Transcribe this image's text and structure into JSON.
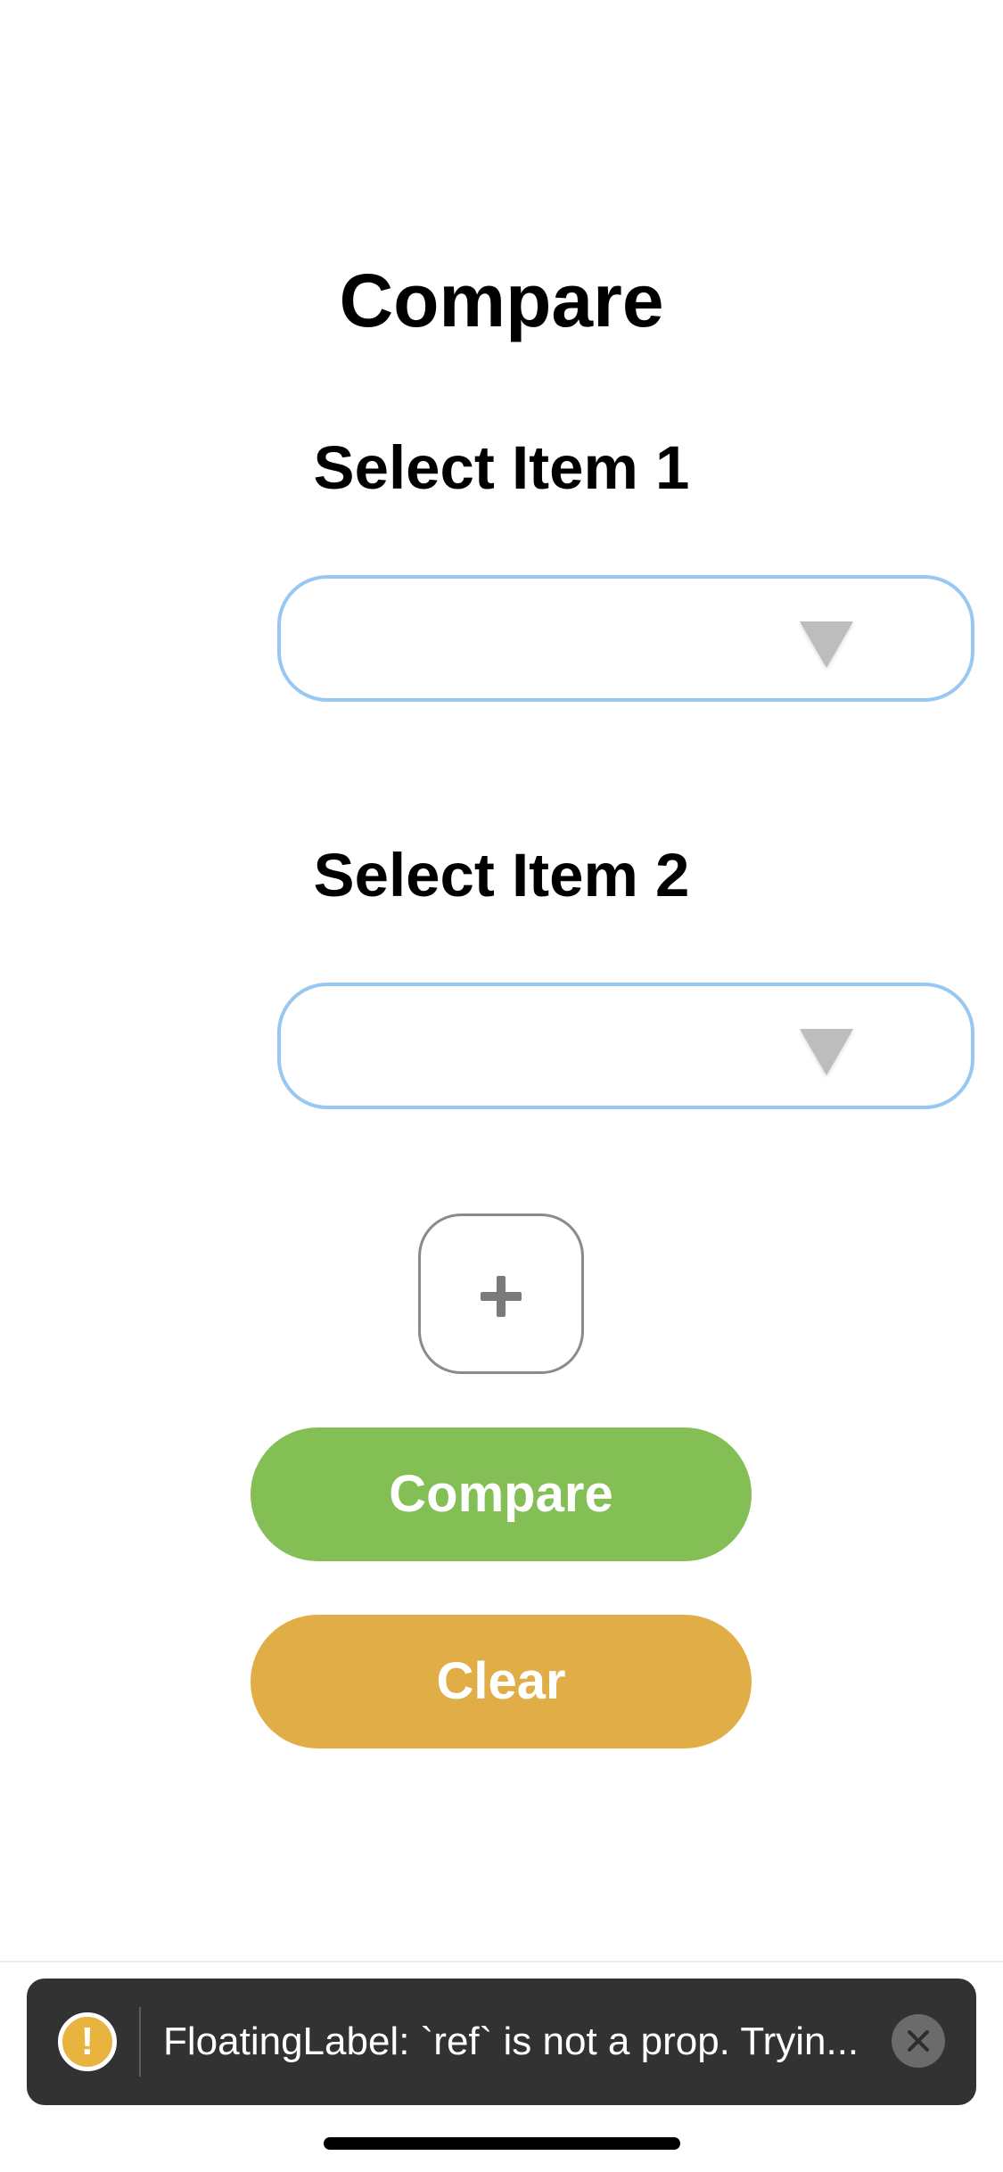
{
  "header": {
    "title": "Compare"
  },
  "item1": {
    "label": "Select Item 1",
    "value": "",
    "icon": "triangle-down-icon"
  },
  "item2": {
    "label": "Select Item 2",
    "value": "",
    "icon": "triangle-down-icon"
  },
  "add_button": {
    "symbol": "+",
    "icon": "plus-icon"
  },
  "actions": {
    "compare_label": "Compare",
    "compare_color": "#84bf55",
    "clear_label": "Clear",
    "clear_color": "#e0ad47"
  },
  "toast": {
    "icon": "warning-icon",
    "icon_glyph": "!",
    "message": "FloatingLabel: `ref` is not a prop. Tryin...",
    "close_icon": "close-icon",
    "icon_color": "#e9b340"
  },
  "colors": {
    "dropdown_border": "#98c8f2",
    "toast_background": "#323232"
  }
}
